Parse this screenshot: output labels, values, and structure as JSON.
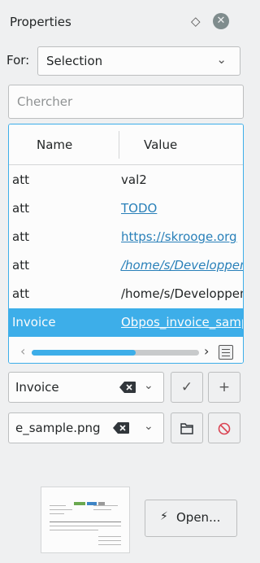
{
  "panel": {
    "title": "Properties",
    "float_icon": "diamond-icon",
    "close_icon": "close-icon",
    "for_label": "For:",
    "for_value": "Selection"
  },
  "search": {
    "placeholder": "Chercher"
  },
  "table": {
    "columns": [
      "Name",
      "Value"
    ],
    "rows": [
      {
        "name": "att",
        "value": "val2",
        "link": false,
        "selected": false
      },
      {
        "name": "att",
        "value": "TODO",
        "link": true,
        "selected": false
      },
      {
        "name": "att",
        "value": "https://skrooge.org",
        "link": true,
        "selected": false
      },
      {
        "name": "att",
        "value": "/home/s/Developpement/",
        "link": true,
        "selected": false
      },
      {
        "name": "att",
        "value": "/home/s/Developpement/",
        "link": false,
        "selected": false
      },
      {
        "name": "Invoice",
        "value": "Obpos_invoice_sample.png",
        "link": true,
        "selected": true
      }
    ],
    "hscroll_fraction": 0.62
  },
  "editor": {
    "name_value": "Invoice",
    "file_value": "e_sample.png",
    "accent": "#3daee9",
    "danger": "#da4453"
  },
  "preview": {
    "open_label": "Open...",
    "open_icon": "lightning-icon"
  }
}
